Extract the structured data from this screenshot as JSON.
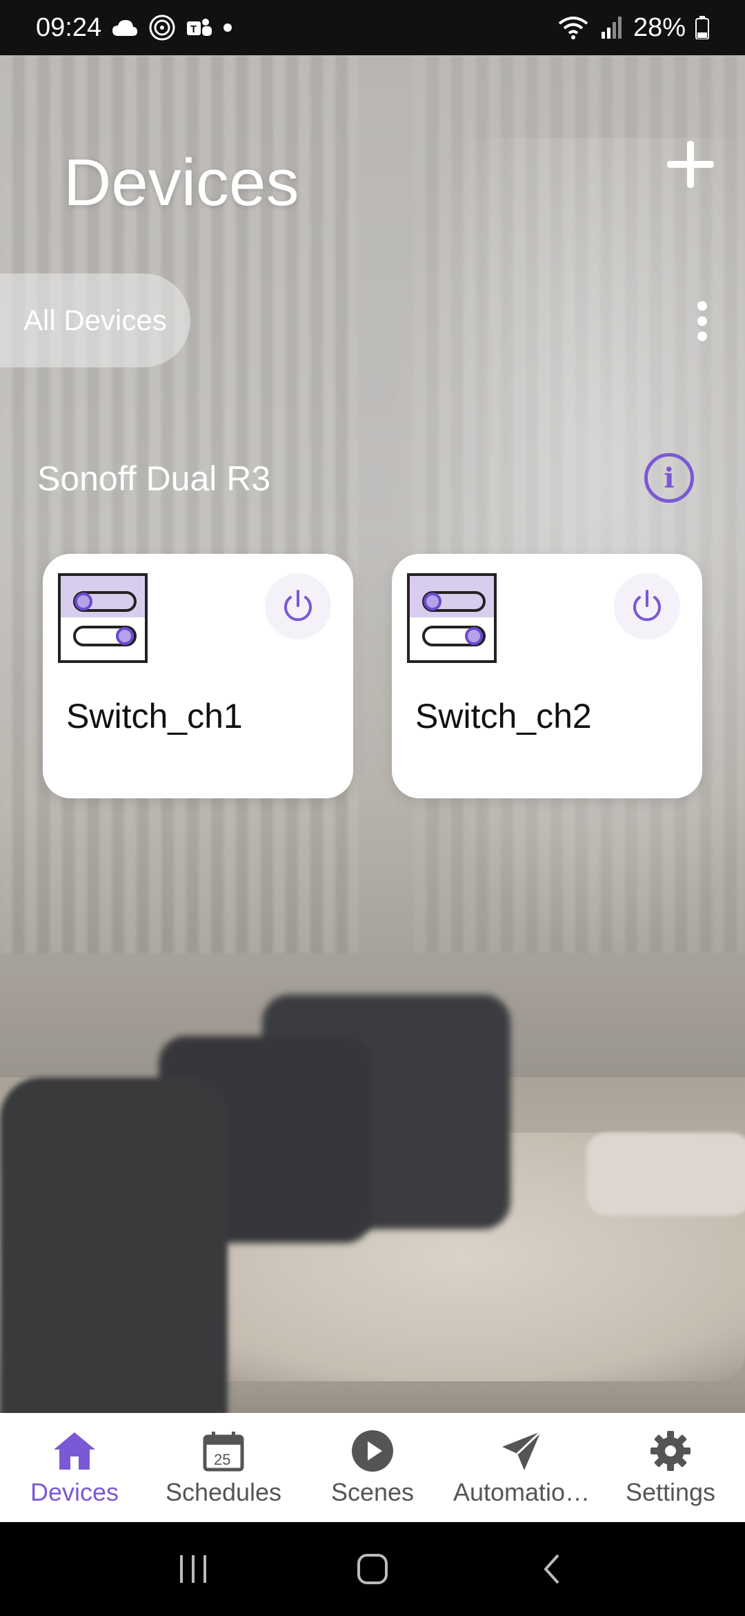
{
  "status_bar": {
    "time": "09:24",
    "battery": "28%",
    "icons_left": [
      "cloud-icon",
      "nfc-icon",
      "teams-icon",
      "dot-icon"
    ],
    "icons_right": [
      "wifi-icon",
      "signal-icon",
      "battery-icon"
    ]
  },
  "header": {
    "title": "Devices",
    "add_icon": "plus-icon",
    "filter_label": "All Devices",
    "more_icon": "more-vertical-icon"
  },
  "group": {
    "title": "Sonoff Dual R3",
    "info_icon": "info-icon"
  },
  "cards": [
    {
      "label": "Switch_ch1",
      "icon": "dual-switch-icon",
      "power_icon": "power-icon"
    },
    {
      "label": "Switch_ch2",
      "icon": "dual-switch-icon",
      "power_icon": "power-icon"
    }
  ],
  "bottom_nav": {
    "items": [
      {
        "label": "Devices",
        "icon": "home-icon",
        "active": true
      },
      {
        "label": "Schedules",
        "icon": "calendar-icon",
        "active": false
      },
      {
        "label": "Scenes",
        "icon": "play-icon",
        "active": false
      },
      {
        "label": "Automatio…",
        "icon": "send-icon",
        "active": false
      },
      {
        "label": "Settings",
        "icon": "gear-icon",
        "active": false
      }
    ],
    "calendar_day": "25"
  },
  "colors": {
    "accent": "#7a58d6",
    "icon_fill": "#d9cdee",
    "nav_inactive": "#555555"
  }
}
